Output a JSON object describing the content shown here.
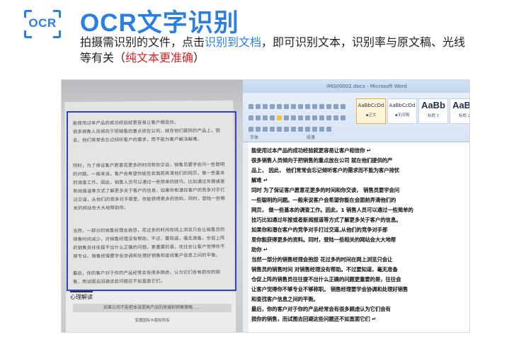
{
  "header": {
    "icon_label": "OCR",
    "title": "OCR文字识别",
    "desc_part1": "拍摄需识别的文件，点击",
    "desc_link": "识别到文档",
    "desc_part2": "，即可识别文本，识别率与原文稿、光线等有关（",
    "desc_red": "纯文本更准确",
    "desc_part3": "）"
  },
  "photo": {
    "paragraphs": [
      "能使用过本产品的成功经验就更容易让客户相信你。",
      "很多销售人员倾向于把销售的重点放在公司，就在他们提供的产品上，因此，他们常常会忘记倾听客户的需求，而不能为客户解决解难。",
      "同时，为了保证客户愿意花更多的时间和你交谈，销售员要学会问一些聪明的问题。一般来说，客户会希望你能在会面前弄清他们的网页，做一些基本的调查工作。因此，销售人员可以通过一些简单的技巧，比如通过年报或者新闻报道等方式了解更多关于客户的信息。如果你和潜在客户的竞争对手打过交道，从他们的竞争对手那里，你能获得更多的资料。同时，登陆一些相关的网站会大大地帮助你。",
      "当然，一部分的销售经理会抱怨，花过多的时间在网上浏览只会让销售员的销售时间减少，对销售经理没有帮助。不过，要知道，毫无准备，仓促上阵的销售员往往提不出什么正确的问题，更重要的是，往往会让客户觉得你不够专业。销售经理要学会协调和处理好销售和查找客户信息之间的平衡。",
      "最后，你的客户对于你的产品经常会有很多顾虑，认为它们会有损你的销售，而试图去回避这些问题还不如直面它们。"
    ],
    "logo": "心理解读",
    "band": "如果公司不能把本该提高产品的发展和销售策略……",
    "credit": "宝德国际®版权所有"
  },
  "word": {
    "title": "IMG00002.docx - Microsoft Word",
    "group_font": "字体",
    "group_paragraph": "段落",
    "styles": [
      {
        "sample": "AaBbCcDd",
        "name": "▪正文"
      },
      {
        "sample": "AaBbCcDd",
        "name": "▪无间隔"
      },
      {
        "sample": "AaBb",
        "name": "标题 1"
      },
      {
        "sample": "AaBb",
        "name": "标题 2"
      }
    ],
    "lines": [
      "能使用过本产品的成功经验就更容易让客户相信你 ↵",
      "很多销售人员倾向于把销售的重点放在公司          就在他们提供的产",
      "品上，          因此，          他们常常会忘记倾听客户的需求而不能为客户排忧",
      "解难 ↵",
      "同时          为了保证客户愿意花更多的时间和你交谈，          销售员要学会问",
      "一些聪明的问题。一般来说客户会希望你能在会面前弄清他们的",
      "网页，          做一些基本的调查工作。因此，1     销售人员可以通过一些简单的",
      "技巧比如通过年报或者新闻报道等方式了解更多关于客户的信息。",
      "如果你和潜在客户的竞争对手打过交道,从他们的竞争对手那",
      "里你能获得更多的资料。同时，登陆一些相关的网站会大大地帮",
      "助你 ↵",
      "当然一部分的销售经理会抱怨          花过多的时间在网上浏览只会让",
      "销售员的销售时间          对销售经理没有帮助。不过要知道，毫无准备",
      "仓促上阵的销售员往往提不出什么正确的问题更重要的是，往往会",
      "让客户觉得你不够专业不够称职。          销售经理要学会协调和处理好销售",
      "和查找客户信息之间的平衡。",
      "最后，你的客户对于你的产品经常会有很多顾虑认为它们会有",
      "损你的销售，而试图去回避这些问题还不如直面它们 ↵"
    ]
  }
}
